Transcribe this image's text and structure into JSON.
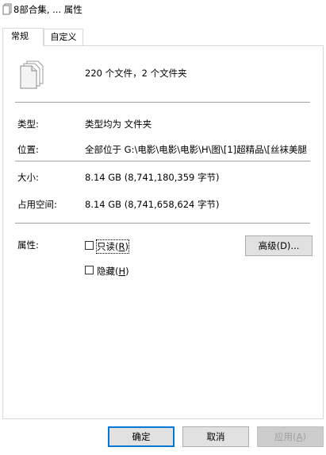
{
  "window": {
    "title": "8部合集, ... 属性"
  },
  "tabs": [
    {
      "label": "常规",
      "active": true
    },
    {
      "label": "自定义",
      "active": false
    }
  ],
  "summary": {
    "text": "220 个文件，2 个文件夹"
  },
  "properties": {
    "type_label": "类型:",
    "type_value": "类型均为 文件夹",
    "location_label": "位置:",
    "location_value": "全部位于 G:\\电影\\电影\\电影\\H\\图\\[1]超精品\\[丝袜美腿",
    "size_label": "大小:",
    "size_value": "8.14 GB (8,741,180,359 字节)",
    "disk_label": "占用空间:",
    "disk_value": "8.14 GB (8,741,658,624 字节)"
  },
  "attributes": {
    "label": "属性:",
    "readonly_prefix": "只读(",
    "readonly_key": "R",
    "readonly_suffix": ")",
    "hidden_prefix": "隐藏(",
    "hidden_key": "H",
    "hidden_suffix": ")",
    "advanced_button": "高级(D)..."
  },
  "buttons": {
    "ok": "确定",
    "cancel": "取消",
    "apply_prefix": "应用(",
    "apply_key": "A",
    "apply_suffix": ")"
  },
  "icons": {
    "title_icon": "folder-multiple-icon",
    "big_icon": "multiple-documents-icon"
  }
}
